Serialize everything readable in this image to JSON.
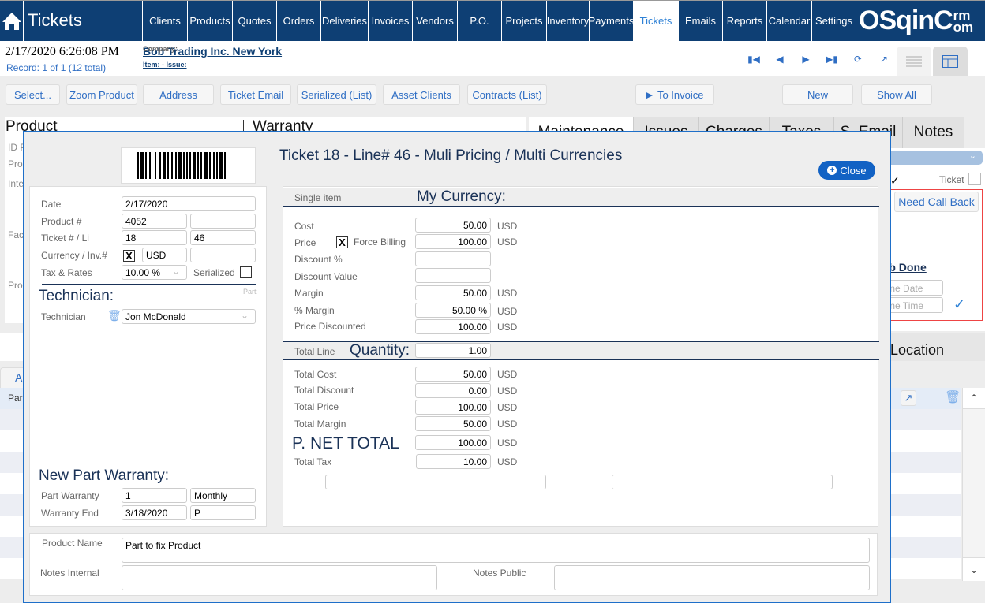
{
  "app": {
    "title": "Tickets"
  },
  "nav": {
    "items": [
      {
        "label": "Clients"
      },
      {
        "label": "Products"
      },
      {
        "label": "Quotes"
      },
      {
        "label": "Orders"
      },
      {
        "label": "Deliveries"
      },
      {
        "label": "Invoices"
      },
      {
        "label": "Vendors"
      },
      {
        "label": "P.O."
      },
      {
        "label": "Projects"
      },
      {
        "label": "Inventory"
      },
      {
        "label": "Payments"
      },
      {
        "label": "Tickets"
      },
      {
        "label": "Emails"
      },
      {
        "label": "Reports"
      },
      {
        "label": "Calendar"
      },
      {
        "label": "Settings"
      }
    ],
    "active": "Tickets",
    "logo_main": "OSqinC",
    "logo_top": "rm",
    "logo_bottom": "om"
  },
  "header": {
    "datetime": "2/17/2020 6:26:08 PM",
    "record": "Record:  1 of 1 (12 total)",
    "company_label": "Company:",
    "company_value": "Bob Trading Inc. New York",
    "item_issue": "Item:  - Issue:"
  },
  "toolbar": {
    "select": "Select...",
    "zoom_product": "Zoom Product",
    "address": "Address",
    "ticket_email": "Ticket Email",
    "serialized_list": "Serialized (List)",
    "asset_clients": "Asset Clients",
    "contracts_list": "Contracts (List)",
    "to_invoice": "To Invoice",
    "new": "New",
    "show_all": "Show All"
  },
  "background": {
    "product_title": "Product",
    "warranty_title": "Warranty",
    "labels": [
      "ID P",
      "Pro",
      "Inte",
      "Fac",
      "Pro"
    ],
    "tabs": [
      "Maintenance",
      "Issues",
      "Charges",
      "Taxes",
      "S. Email",
      "Notes"
    ],
    "ticket_label": "Ticket",
    "need_call_back": "Need Call Back",
    "job_done": "Job Done",
    "done_date_placeholder": "Done Date",
    "done_time_placeholder": "Done Time",
    "location": "Location",
    "grid_tab": "A",
    "grid_row_first": "Par"
  },
  "modal": {
    "title": "Ticket 18 - Line# 46 - Muli Pricing / Multi Currencies",
    "close_label": "Close",
    "left": {
      "date_label": "Date",
      "date_value": "2/17/2020",
      "product_label": "Product #",
      "product_value": "4052",
      "product_extra": "",
      "ticket_label": "Ticket # / Li",
      "ticket_value": "18",
      "line_value": "46",
      "currency_label": "Currency / Inv.#",
      "currency_checked": "X",
      "currency_value": "USD",
      "inv_value": "",
      "tax_label": "Tax & Rates",
      "tax_value": "10.00 %",
      "serialized_label": "Serialized",
      "technician_section": "Technician:",
      "part_hint": "Part",
      "technician_label": "Technician",
      "technician_value": "Jon McDonald",
      "warranty_section": "New Part Warranty:",
      "part_warranty_label": "Part Warranty",
      "part_warranty_value": "1",
      "part_warranty_period": "Monthly",
      "warranty_end_label": "Warranty End",
      "warranty_end_value": "3/18/2020",
      "warranty_end_code": "P"
    },
    "single": {
      "band_label": "Single item",
      "band_title": "My Currency:",
      "rows": [
        {
          "label": "Cost",
          "value": "50.00",
          "currency": "USD"
        },
        {
          "label": "Price",
          "value": "100.00",
          "currency": "USD"
        },
        {
          "label": "Discount %",
          "value": "",
          "currency": ""
        },
        {
          "label": "Discount Value",
          "value": "",
          "currency": ""
        },
        {
          "label": "Margin",
          "value": "50.00",
          "currency": "USD"
        },
        {
          "label": "% Margin",
          "value": "50.00 %",
          "currency": "USD"
        },
        {
          "label": "Price Discounted",
          "value": "100.00",
          "currency": "USD"
        }
      ],
      "force_billing_label": "Force Billing",
      "force_billing_checked": "X"
    },
    "total": {
      "band_label": "Total Line",
      "quantity_label": "Quantity:",
      "quantity_value": "1.00",
      "rows": [
        {
          "label": "Total Cost",
          "value": "50.00",
          "currency": "USD"
        },
        {
          "label": "Total Discount",
          "value": "0.00",
          "currency": "USD"
        },
        {
          "label": "Total Price",
          "value": "100.00",
          "currency": "USD"
        },
        {
          "label": "Total Margin",
          "value": "50.00",
          "currency": "USD"
        },
        {
          "label": "P. NET TOTAL",
          "value": "100.00",
          "currency": "USD"
        },
        {
          "label": "Total Tax",
          "value": "10.00",
          "currency": "USD"
        }
      ]
    },
    "bottom": {
      "product_name_label": "Product Name",
      "product_name_value": "Part to fix Product",
      "notes_internal_label": "Notes Internal",
      "notes_internal_value": "",
      "notes_public_label": "Notes Public",
      "notes_public_value": ""
    }
  },
  "colors": {
    "navbar": "#0e3f74",
    "accent": "#2f6ec4",
    "close_button": "#1262c4",
    "active_tab_text": "#2f82d6"
  }
}
